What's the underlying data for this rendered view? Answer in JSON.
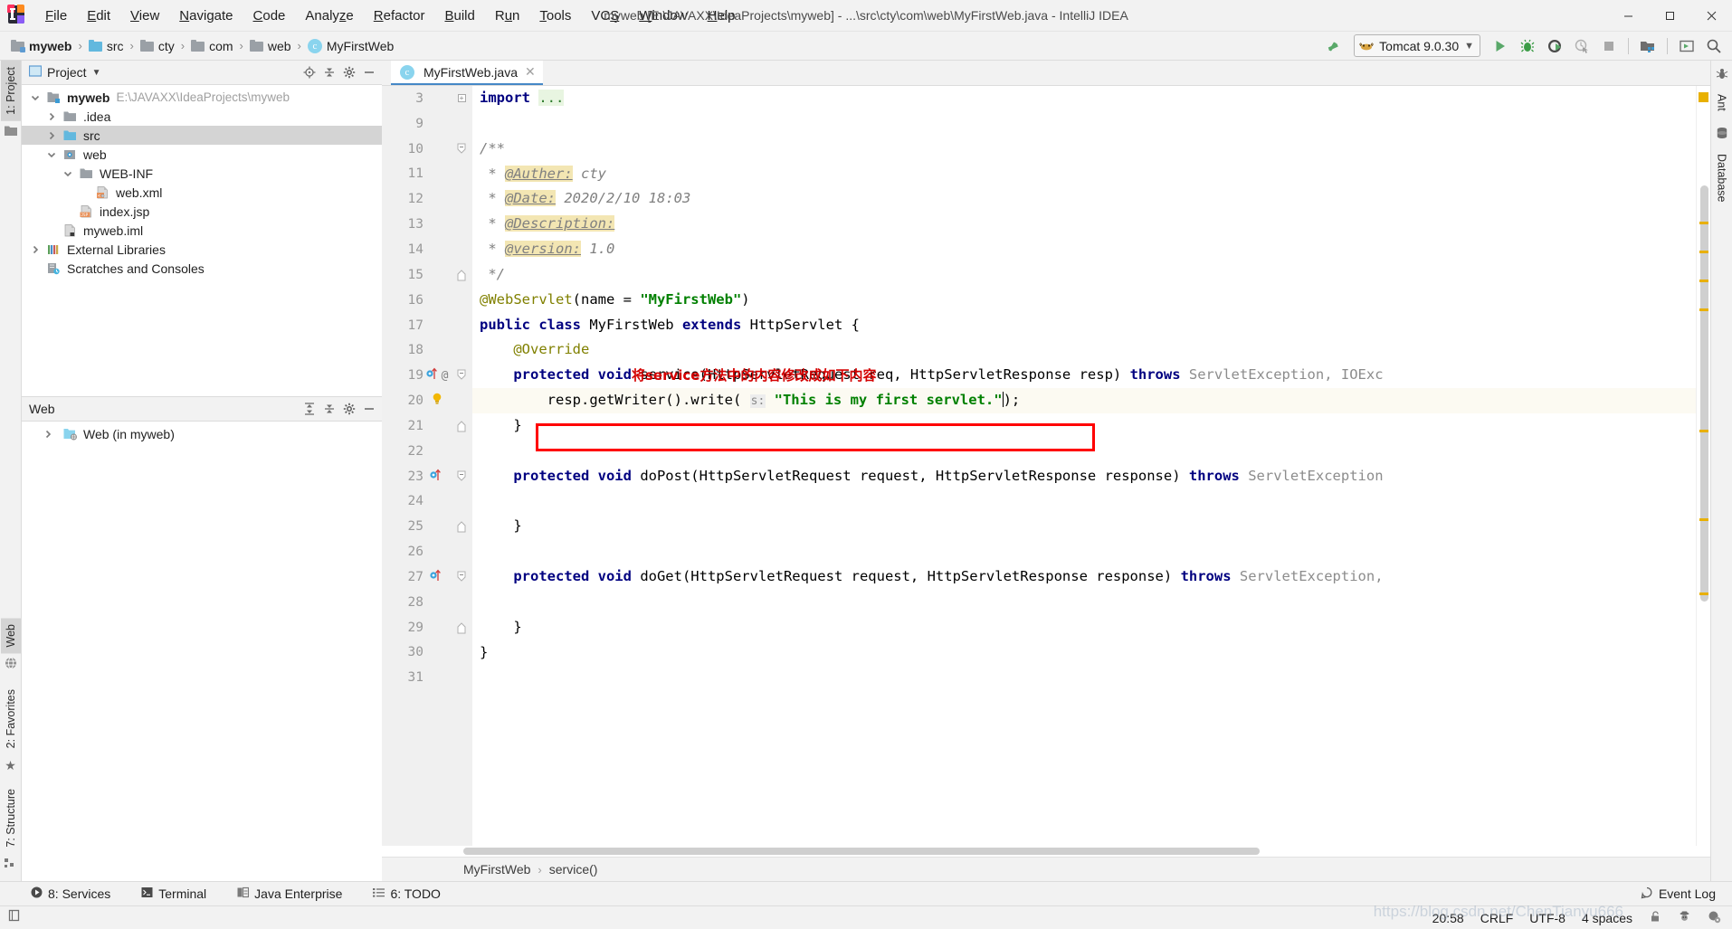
{
  "window": {
    "title": "myweb [E:\\JAVAXX\\IdeaProjects\\myweb] - ...\\src\\cty\\com\\web\\MyFirstWeb.java - IntelliJ IDEA",
    "app_logo": "intellij-idea-logo",
    "minimize_label": "Minimize",
    "maximize_label": "Maximize",
    "close_label": "Close"
  },
  "menubar": {
    "items": [
      {
        "label": "File",
        "mnemonic": "F"
      },
      {
        "label": "Edit",
        "mnemonic": "E"
      },
      {
        "label": "View",
        "mnemonic": "V"
      },
      {
        "label": "Navigate",
        "mnemonic": "N"
      },
      {
        "label": "Code",
        "mnemonic": "C"
      },
      {
        "label": "Analyze",
        "mnemonic": "z"
      },
      {
        "label": "Refactor",
        "mnemonic": "R"
      },
      {
        "label": "Build",
        "mnemonic": "B"
      },
      {
        "label": "Run",
        "mnemonic": "u"
      },
      {
        "label": "Tools",
        "mnemonic": "T"
      },
      {
        "label": "VCS",
        "mnemonic": "S"
      },
      {
        "label": "Window",
        "mnemonic": "W"
      },
      {
        "label": "Help",
        "mnemonic": "H"
      }
    ]
  },
  "navbar": {
    "crumbs": [
      {
        "label": "myweb",
        "icon": "module-folder-icon",
        "bold": true
      },
      {
        "label": "src",
        "icon": "source-folder-icon",
        "bold": false
      },
      {
        "label": "cty",
        "icon": "package-folder-icon",
        "bold": false
      },
      {
        "label": "com",
        "icon": "package-folder-icon",
        "bold": false
      },
      {
        "label": "web",
        "icon": "package-folder-icon",
        "bold": false
      },
      {
        "label": "MyFirstWeb",
        "icon": "java-class-icon",
        "bold": false
      }
    ],
    "separator": "›",
    "run_config": {
      "name": "Tomcat 9.0.30",
      "icon": "tomcat-icon",
      "chevron": "⌄"
    },
    "buttons": [
      {
        "name": "build-project-button",
        "icon": "hammer-icon"
      },
      {
        "name": "run-button",
        "icon": "run-triangle-icon"
      },
      {
        "name": "debug-button",
        "icon": "debug-bug-icon"
      },
      {
        "name": "run-coverage-button",
        "icon": "coverage-icon"
      },
      {
        "name": "profile-button",
        "icon": "profiler-icon"
      },
      {
        "name": "stop-button",
        "icon": "stop-square-icon"
      },
      {
        "name": "update-app-button",
        "icon": "update-folder-icon"
      },
      {
        "name": "select-target-button",
        "icon": "deploy-icon"
      },
      {
        "name": "search-everywhere-button",
        "icon": "search-icon"
      }
    ]
  },
  "left_rail": {
    "tabs": [
      {
        "label": "1: Project",
        "mnemonic": "1",
        "icon": "project-icon",
        "active": true
      },
      {
        "label": "Web",
        "icon": "web-globe-icon",
        "active": true
      },
      {
        "label": "2: Favorites",
        "mnemonic": "2",
        "icon": "star-icon",
        "active": false
      },
      {
        "label": "7: Structure",
        "mnemonic": "7",
        "icon": "structure-icon",
        "active": false
      }
    ]
  },
  "right_rail": {
    "tabs": [
      {
        "label": "Ant",
        "icon": "ant-icon"
      },
      {
        "label": "Database",
        "icon": "database-icon"
      }
    ]
  },
  "project_panel": {
    "title": "Project",
    "dropdown": "▾",
    "icons": [
      {
        "name": "locate-file-icon"
      },
      {
        "name": "collapse-all-icon"
      },
      {
        "name": "settings-gear-icon"
      },
      {
        "name": "hide-panel-icon"
      }
    ],
    "tree": [
      {
        "label": "myweb",
        "path": "E:\\JAVAXX\\IdeaProjects\\myweb",
        "depth": 0,
        "arrow": "down",
        "icon": "module-icon",
        "bold": true,
        "selected": false
      },
      {
        "label": ".idea",
        "path": "",
        "depth": 1,
        "arrow": "right",
        "icon": "folder-gray-icon",
        "bold": false,
        "selected": false
      },
      {
        "label": "src",
        "path": "",
        "depth": 1,
        "arrow": "right",
        "icon": "folder-blue-icon",
        "bold": false,
        "selected": true
      },
      {
        "label": "web",
        "path": "",
        "depth": 1,
        "arrow": "down",
        "icon": "web-root-icon",
        "bold": false,
        "selected": false
      },
      {
        "label": "WEB-INF",
        "path": "",
        "depth": 2,
        "arrow": "down",
        "icon": "folder-gray-icon",
        "bold": false,
        "selected": false
      },
      {
        "label": "web.xml",
        "path": "",
        "depth": 3,
        "arrow": "none",
        "icon": "xml-file-icon",
        "bold": false,
        "selected": false
      },
      {
        "label": "index.jsp",
        "path": "",
        "depth": 2,
        "arrow": "none",
        "icon": "jsp-file-icon",
        "bold": false,
        "selected": false
      },
      {
        "label": "myweb.iml",
        "path": "",
        "depth": 1,
        "arrow": "none",
        "icon": "iml-file-icon",
        "bold": false,
        "selected": false
      },
      {
        "label": "External Libraries",
        "path": "",
        "depth": 0,
        "arrow": "right",
        "icon": "libraries-icon",
        "bold": false,
        "selected": false
      },
      {
        "label": "Scratches and Consoles",
        "path": "",
        "depth": 0,
        "arrow": "none",
        "icon": "scratches-icon",
        "bold": false,
        "selected": false
      }
    ]
  },
  "web_panel": {
    "title": "Web",
    "icons": [
      {
        "name": "expand-all-icon"
      },
      {
        "name": "collapse-all-icon"
      },
      {
        "name": "settings-gear-icon"
      },
      {
        "name": "hide-panel-icon"
      }
    ],
    "tree": [
      {
        "label": "Web (in myweb)",
        "depth": 0,
        "arrow": "right",
        "icon": "web-facet-icon"
      }
    ]
  },
  "editor": {
    "tab": {
      "label": "MyFirstWeb.java",
      "icon": "java-class-icon",
      "close": "✕"
    },
    "lines": [
      {
        "num": "3",
        "fold": "plus",
        "marks": [],
        "highlight": false
      },
      {
        "num": "9",
        "fold": "none",
        "marks": [],
        "highlight": false
      },
      {
        "num": "10",
        "fold": "open",
        "marks": [],
        "highlight": false
      },
      {
        "num": "11",
        "fold": "none",
        "marks": [],
        "highlight": false
      },
      {
        "num": "12",
        "fold": "none",
        "marks": [],
        "highlight": false
      },
      {
        "num": "13",
        "fold": "none",
        "marks": [],
        "highlight": false
      },
      {
        "num": "14",
        "fold": "none",
        "marks": [],
        "highlight": false
      },
      {
        "num": "15",
        "fold": "close",
        "marks": [],
        "highlight": false
      },
      {
        "num": "16",
        "fold": "none",
        "marks": [],
        "highlight": false
      },
      {
        "num": "17",
        "fold": "none",
        "marks": [],
        "highlight": false
      },
      {
        "num": "18",
        "fold": "none",
        "marks": [],
        "highlight": false
      },
      {
        "num": "19",
        "fold": "open",
        "marks": [
          "override-gutter-icon",
          "annotation-gutter-icon"
        ],
        "highlight": false
      },
      {
        "num": "20",
        "fold": "none",
        "marks": [
          "intention-bulb-icon"
        ],
        "highlight": true
      },
      {
        "num": "21",
        "fold": "close",
        "marks": [],
        "highlight": false
      },
      {
        "num": "22",
        "fold": "none",
        "marks": [],
        "highlight": false
      },
      {
        "num": "23",
        "fold": "open",
        "marks": [
          "implementing-gutter-icon"
        ],
        "highlight": false
      },
      {
        "num": "24",
        "fold": "none",
        "marks": [],
        "highlight": false
      },
      {
        "num": "25",
        "fold": "close",
        "marks": [],
        "highlight": false
      },
      {
        "num": "26",
        "fold": "none",
        "marks": [],
        "highlight": false
      },
      {
        "num": "27",
        "fold": "open",
        "marks": [
          "implementing-gutter-icon"
        ],
        "highlight": false
      },
      {
        "num": "28",
        "fold": "none",
        "marks": [],
        "highlight": false
      },
      {
        "num": "29",
        "fold": "close",
        "marks": [],
        "highlight": false
      },
      {
        "num": "30",
        "fold": "none",
        "marks": [],
        "highlight": false
      },
      {
        "num": "31",
        "fold": "none",
        "marks": [],
        "highlight": false
      }
    ],
    "code": {
      "l3_import": "import",
      "l3_dots": "...",
      "l10": "/**",
      "l11_star": " * ",
      "l11_tag": "@Auther:",
      "l11_val": " cty",
      "l12_star": " * ",
      "l12_tag": "@Date:",
      "l12_val": " 2020/2/10 18:03",
      "l13_star": " * ",
      "l13_tag": "@Description:",
      "l13_val": "",
      "l14_star": " * ",
      "l14_tag": "@version:",
      "l14_val": " 1.0",
      "l15": " */",
      "l16_anno": "@WebServlet",
      "l16_rest": "(name = ",
      "l16_str": "\"MyFirstWeb\"",
      "l16_end": ")",
      "l17_kw1": "public class",
      "l17_name": " MyFirstWeb ",
      "l17_kw2": "extends",
      "l17_rest": " HttpServlet {",
      "l18_override": "    @Override",
      "l18_note": "将service方法中的内容修改成如下内容",
      "l19_kw": "    protected void",
      "l19_sig": " service(HttpServletRequest req, HttpServletResponse resp) ",
      "l19_throws": "throws",
      "l19_exc": " ServletException, IOExc",
      "l20_call": "        resp.getWriter().write( ",
      "l20_hint": "s:",
      "l20_str": " \"This is my first servlet.\"",
      "l20_end": ");",
      "l21": "    }",
      "l23_kw": "    protected void",
      "l23_sig": " doPost(HttpServletRequest request, HttpServletResponse response) ",
      "l23_throws": "throws",
      "l23_exc": " ServletException",
      "l25": "    }",
      "l27_kw": "    protected void",
      "l27_sig": " doGet(HttpServletRequest request, HttpServletResponse response) ",
      "l27_throws": "throws",
      "l27_exc": " ServletException,",
      "l29": "    }",
      "l30": "}"
    },
    "breadcrumbs": [
      {
        "label": "MyFirstWeb"
      },
      {
        "label": "service()"
      }
    ],
    "breadcrumb_sep": "›"
  },
  "bottom_bar": {
    "items": [
      {
        "label": "8: Services",
        "mnemonic": "8",
        "icon": "services-play-icon"
      },
      {
        "label": "Terminal",
        "mnemonic": "",
        "icon": "terminal-icon"
      },
      {
        "label": "Java Enterprise",
        "mnemonic": "",
        "icon": "java-enterprise-icon"
      },
      {
        "label": "6: TODO",
        "mnemonic": "6",
        "icon": "todo-list-icon"
      }
    ],
    "event_log": {
      "label": "Event Log",
      "icon": "event-log-icon"
    }
  },
  "status_bar": {
    "left_icon": "toggle-tool-window-bars-icon",
    "watermark": "https://blog.csdn.net/ChenTianyu666",
    "items": [
      {
        "name": "caret-position",
        "label": "20:58"
      },
      {
        "name": "line-separator",
        "label": "CRLF"
      },
      {
        "name": "file-encoding",
        "label": "UTF-8"
      },
      {
        "name": "indent-setting",
        "label": "4 spaces"
      }
    ],
    "icons": [
      {
        "name": "lock-icon"
      },
      {
        "name": "inspection-hector-icon"
      },
      {
        "name": "background-tasks-icon"
      }
    ]
  }
}
